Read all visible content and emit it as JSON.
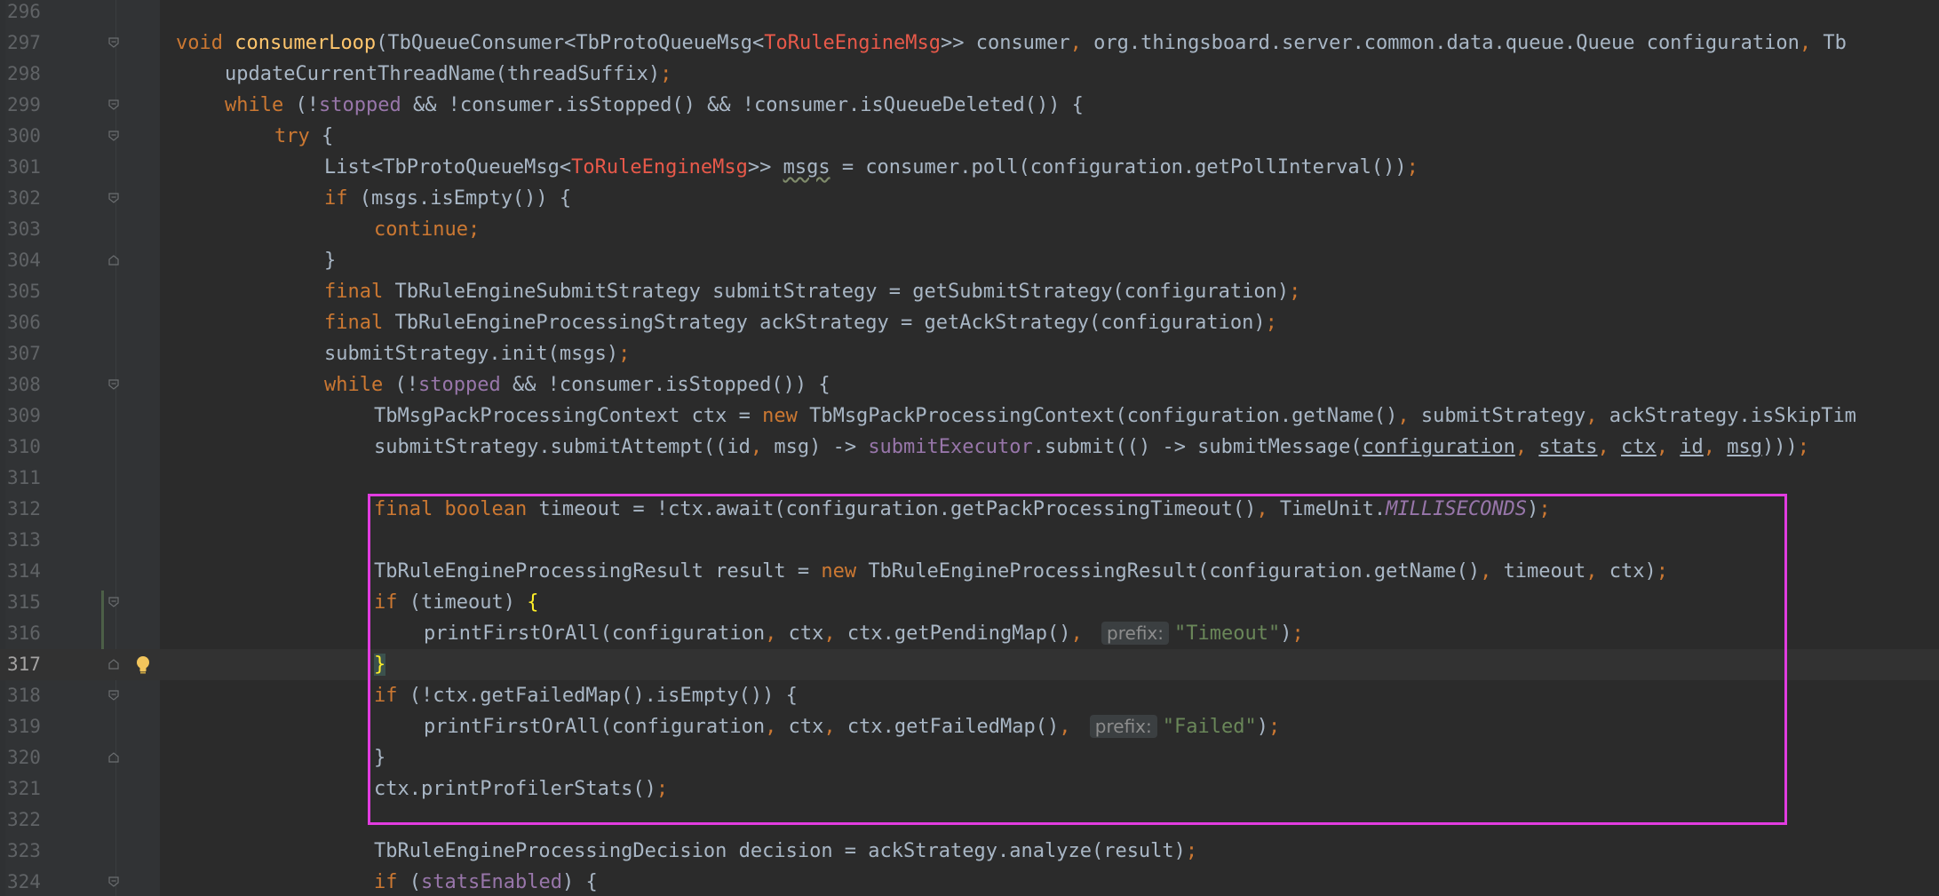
{
  "editor": {
    "background": "#2b2b2b",
    "gutter_background": "#313335",
    "highlight_box_color": "#e23ce0",
    "current_line": "317",
    "line_numbers": [
      "296",
      "297",
      "298",
      "299",
      "300",
      "301",
      "302",
      "303",
      "304",
      "305",
      "306",
      "307",
      "308",
      "309",
      "310",
      "311",
      "312",
      "313",
      "314",
      "315",
      "316",
      "317",
      "318",
      "319",
      "320",
      "321",
      "322",
      "323",
      "324"
    ]
  },
  "code": {
    "l297": {
      "a": "void ",
      "b": "consumerLoop",
      "c": "(TbQueueConsumer<TbProtoQueueMsg<",
      "d": "ToRuleEngineMsg",
      "e": ">> consumer",
      "f": ", ",
      "g": "org.thingsboard.server.common.data.queue.Queue configuration",
      "h": ", ",
      "i": "Tb"
    },
    "l298": {
      "a": "updateCurrentThreadName(threadSuffix)",
      "b": ";"
    },
    "l299": {
      "a": "while ",
      "b": "(!",
      "c": "stopped",
      "d": " && !consumer.isStopped() && !consumer.isQueueDeleted()) {"
    },
    "l300": {
      "a": "try ",
      "b": "{"
    },
    "l301": {
      "a": "List<TbProtoQueueMsg<",
      "b": "ToRuleEngineMsg",
      "c": ">> ",
      "d": "msgs",
      "e": " = consumer.poll(configuration.getPollInterval())",
      "f": ";"
    },
    "l302": {
      "a": "if ",
      "b": "(msgs.isEmpty()) {"
    },
    "l303": {
      "a": "continue;"
    },
    "l304": {
      "a": "}"
    },
    "l305": {
      "a": "final ",
      "b": "TbRuleEngineSubmitStrategy submitStrategy = getSubmitStrategy(configuration)",
      "c": ";"
    },
    "l306": {
      "a": "final ",
      "b": "TbRuleEngineProcessingStrategy ackStrategy = getAckStrategy(configuration)",
      "c": ";"
    },
    "l307": {
      "a": "submitStrategy.init(msgs)",
      "b": ";"
    },
    "l308": {
      "a": "while ",
      "b": "(!",
      "c": "stopped",
      "d": " && !consumer.isStopped()) {"
    },
    "l309": {
      "a": "TbMsgPackProcessingContext ctx = ",
      "b": "new ",
      "c": "TbMsgPackProcessingContext(configuration.getName()",
      "d": ", ",
      "e": "submitStrategy",
      "f": ", ",
      "g": "ackStrategy.isSkipTim"
    },
    "l310": {
      "a": "submitStrategy.submitAttempt((id",
      "b": ", ",
      "c": "msg) -> ",
      "d": "submitExecutor",
      "e": ".submit(() -> submitMessage(",
      "f": "configuration",
      "g": ", ",
      "h": "stats",
      "i": ", ",
      "j": "ctx",
      "k": ", ",
      "l": "id",
      "m": ", ",
      "n": "msg",
      "o": ")))",
      "p": ";"
    },
    "l312": {
      "a": "final boolean ",
      "b": "timeout = !ctx.await(configuration.getPackProcessingTimeout()",
      "c": ", ",
      "d": "TimeUnit.",
      "e": "MILLISECONDS",
      "f": ")",
      "g": ";"
    },
    "l314": {
      "a": "TbRuleEngineProcessingResult result = ",
      "b": "new ",
      "c": "TbRuleEngineProcessingResult(configuration.getName()",
      "d": ", ",
      "e": "timeout",
      "f": ", ",
      "g": "ctx)",
      "h": ";"
    },
    "l315": {
      "a": "if ",
      "b": "(timeout) ",
      "c": "{"
    },
    "l316": {
      "a": "printFirstOrAll(configuration",
      "b": ", ",
      "c": "ctx",
      "d": ", ",
      "e": "ctx.getPendingMap()",
      "f": ", ",
      "hint": "prefix:",
      "g": "\"Timeout\"",
      "h": ")",
      "i": ";"
    },
    "l317": {
      "a": "}"
    },
    "l318": {
      "a": "if ",
      "b": "(!ctx.getFailedMap().isEmpty()) {"
    },
    "l319": {
      "a": "printFirstOrAll(configuration",
      "b": ", ",
      "c": "ctx",
      "d": ", ",
      "e": "ctx.getFailedMap()",
      "f": ", ",
      "hint": "prefix:",
      "g": "\"Failed\"",
      "h": ")",
      "i": ";"
    },
    "l320": {
      "a": "}"
    },
    "l321": {
      "a": "ctx.printProfilerStats()",
      "b": ";"
    },
    "l323": {
      "a": "TbRuleEngineProcessingDecision decision = ackStrategy.analyze(result)",
      "b": ";"
    },
    "l324": {
      "a": "if ",
      "b": "(",
      "c": "statsEnabled",
      "d": ") {"
    }
  }
}
